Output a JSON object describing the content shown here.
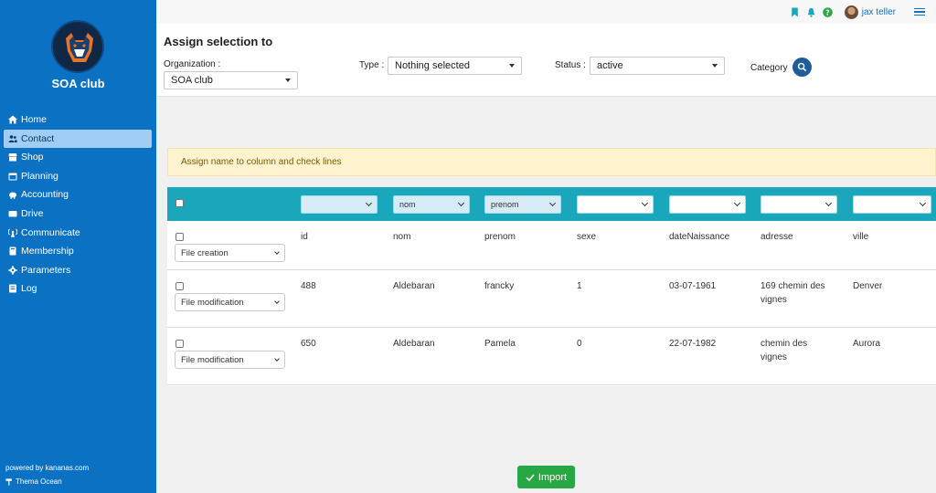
{
  "sidebar": {
    "brand": "SOA club",
    "items": [
      {
        "label": "Home",
        "icon": "home-icon"
      },
      {
        "label": "Contact",
        "icon": "users-icon"
      },
      {
        "label": "Shop",
        "icon": "shop-icon"
      },
      {
        "label": "Planning",
        "icon": "calendar-icon"
      },
      {
        "label": "Accounting",
        "icon": "piggy-bank-icon"
      },
      {
        "label": "Drive",
        "icon": "drive-icon"
      },
      {
        "label": "Communicate",
        "icon": "broadcast-icon"
      },
      {
        "label": "Membership",
        "icon": "id-card-icon"
      },
      {
        "label": "Parameters",
        "icon": "gear-icon"
      },
      {
        "label": "Log",
        "icon": "log-icon"
      }
    ],
    "active_index": 1,
    "powered": "powered by kananas.com",
    "theme": "Thema Ocean"
  },
  "topbar": {
    "user_name": "jax teller"
  },
  "panel": {
    "title": "Assign selection to",
    "organization_label": "Organization :",
    "organization_value": "SOA club",
    "type_label": "Type :",
    "type_value": "Nothing selected",
    "status_label": "Status :",
    "status_value": "active",
    "category_label": "Category"
  },
  "alert": "Assign name to column and check lines",
  "table": {
    "header_selects": [
      "",
      "nom",
      "prenom",
      "",
      "",
      "",
      ""
    ],
    "rows": [
      {
        "action": "File creation",
        "cells": [
          "id",
          "nom",
          "prenom",
          "sexe",
          "dateNaissance",
          "adresse",
          "ville"
        ]
      },
      {
        "action": "File modification",
        "cells": [
          "488",
          "Aldebaran",
          "francky",
          "1",
          "03-07-1961",
          "169 chemin des vignes",
          "Denver"
        ]
      },
      {
        "action": "File modification",
        "cells": [
          "650",
          "Aldebaran",
          "Pamela",
          "0",
          "22-07-1982",
          "chemin des vignes",
          "Aurora"
        ]
      }
    ]
  },
  "import_label": "Import",
  "colors": {
    "sidebar": "#0b72c3",
    "table_header": "#1aa6bb",
    "import_button": "#28a745",
    "category_button": "#1e5c9a"
  }
}
